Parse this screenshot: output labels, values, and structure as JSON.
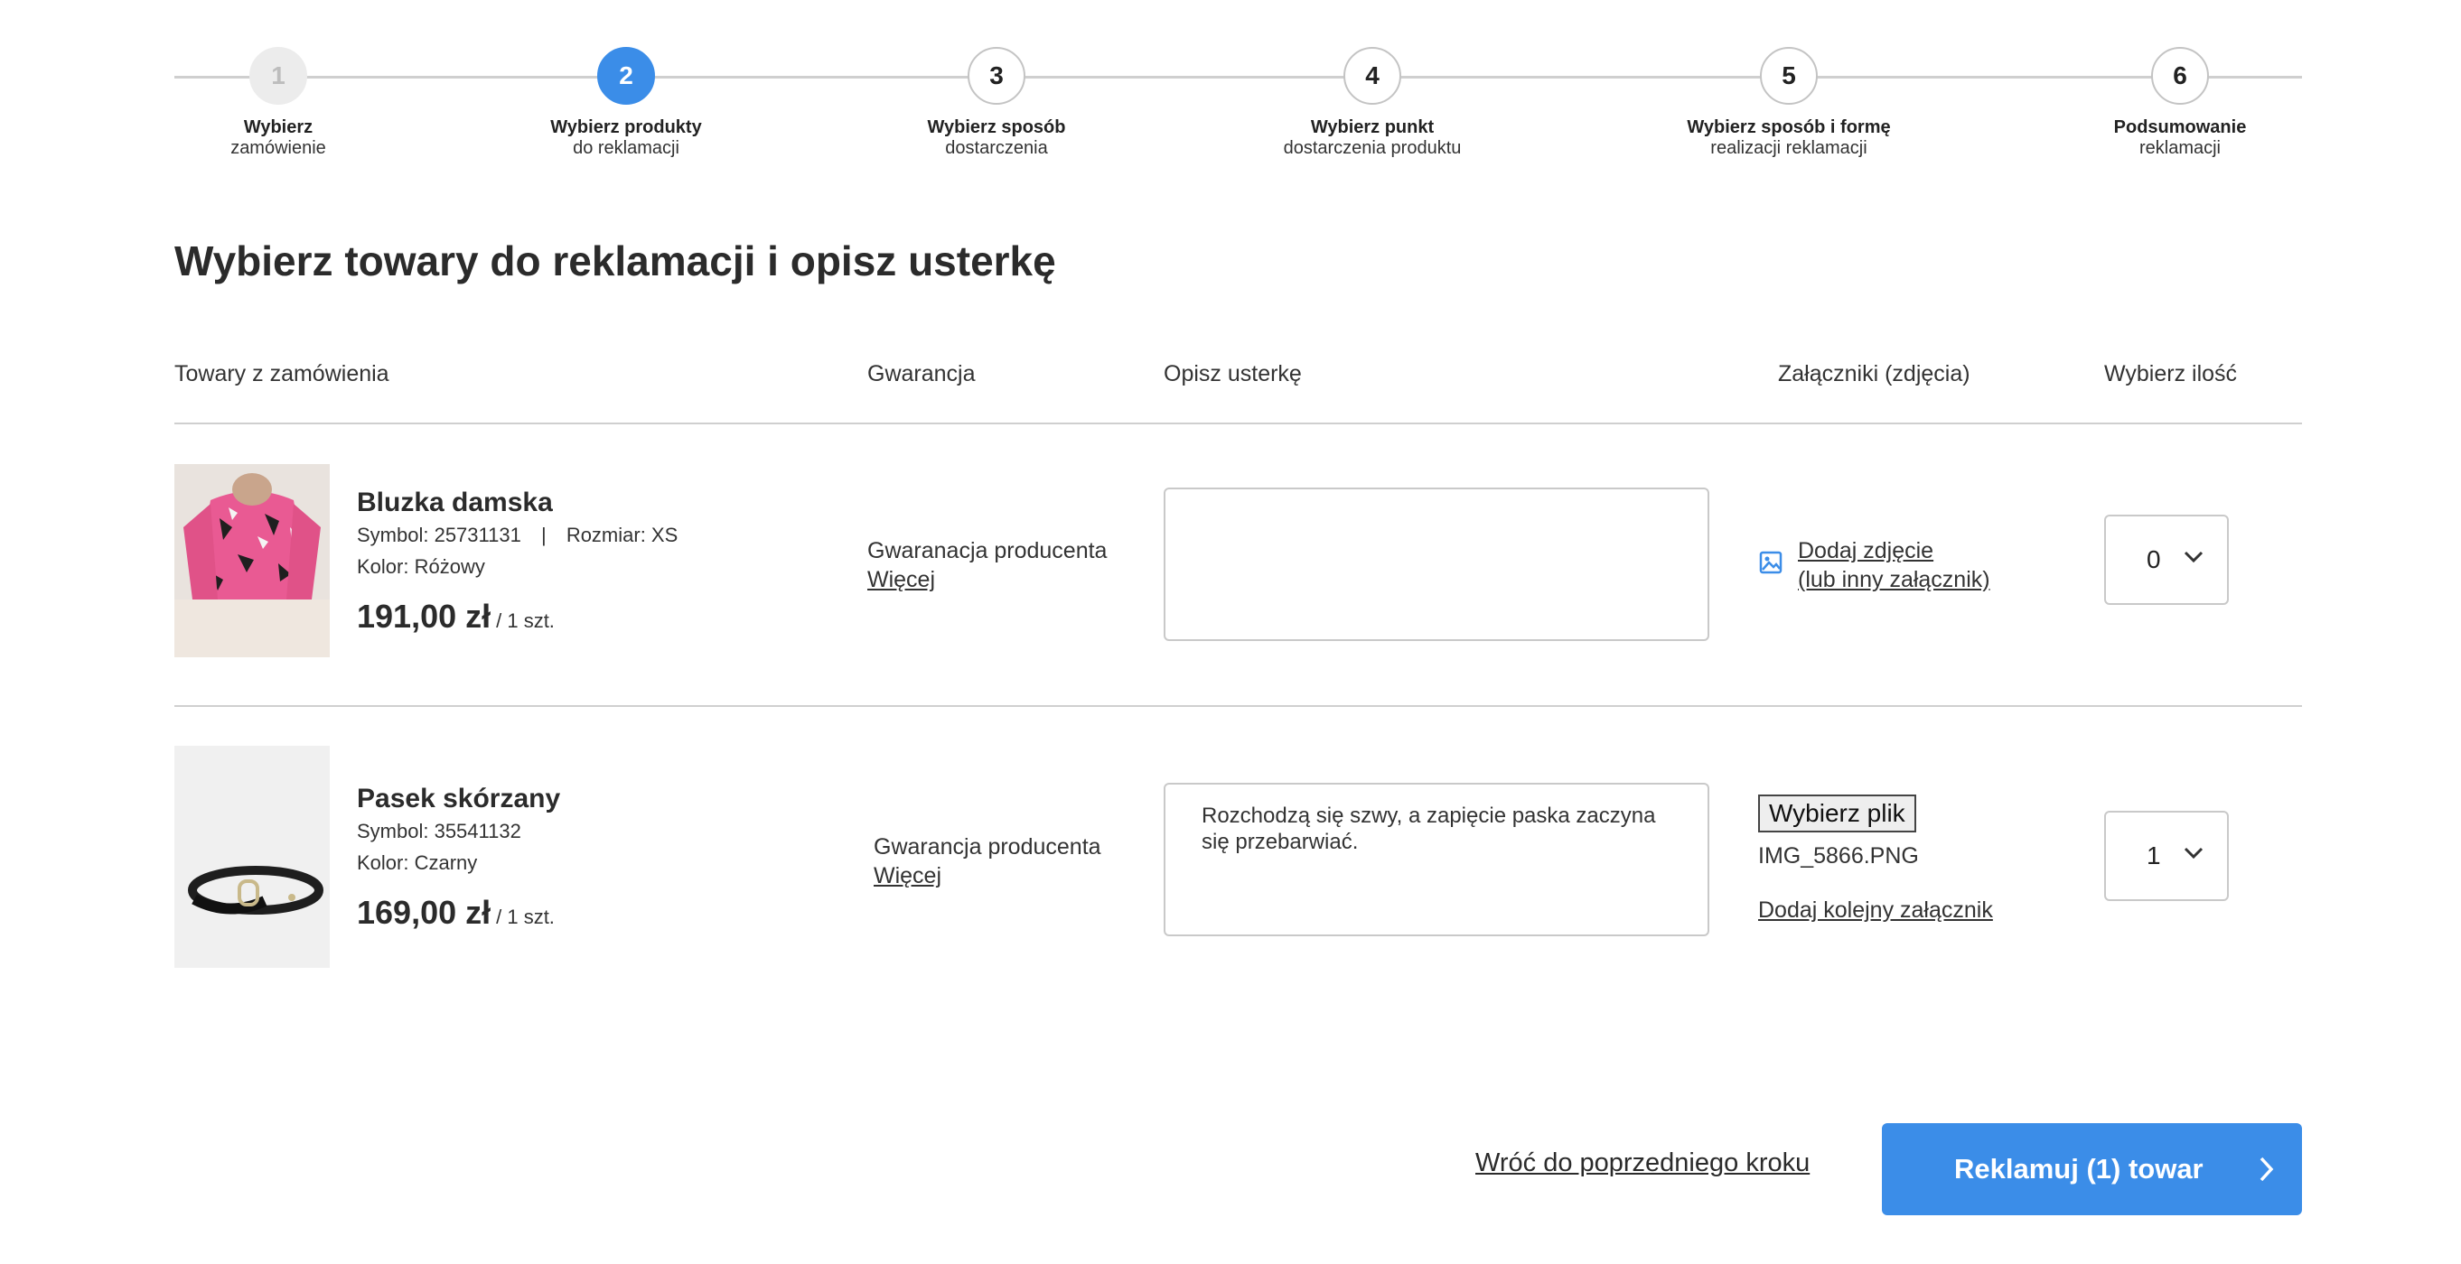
{
  "stepper": {
    "steps": [
      {
        "number": "1",
        "title": "Wybierz",
        "subtitle": "zamówienie",
        "state": "done"
      },
      {
        "number": "2",
        "title": "Wybierz produkty",
        "subtitle": "do reklamacji",
        "state": "active"
      },
      {
        "number": "3",
        "title": "Wybierz sposób",
        "subtitle": "dostarczenia",
        "state": "upcoming"
      },
      {
        "number": "4",
        "title": "Wybierz punkt",
        "subtitle": "dostarczenia produktu",
        "state": "upcoming"
      },
      {
        "number": "5",
        "title": "Wybierz sposób i formę",
        "subtitle": "realizacji reklamacji",
        "state": "upcoming"
      },
      {
        "number": "6",
        "title": "Podsumowanie",
        "subtitle": "reklamacji",
        "state": "upcoming"
      }
    ]
  },
  "page_title": "Wybierz towary do reklamacji i opisz usterkę",
  "table_header": {
    "products": "Towary z zamówienia",
    "warranty": "Gwarancja",
    "description": "Opisz usterkę",
    "attachments": "Załączniki (zdjęcia)",
    "quantity": "Wybierz ilość"
  },
  "items": [
    {
      "name": "Bluzka damska",
      "symbol": "Symbol: 25731131",
      "separator": "|",
      "size": "Rozmiar: XS",
      "color": "Kolor: Różowy",
      "price": "191,00 zł",
      "unit": "/ 1 szt.",
      "warranty": "Gwaranacja producenta",
      "warranty_more": "Więcej",
      "description": "",
      "attach_link_line1": "Dodaj zdjęcie",
      "attach_link_line2": "(lub inny załącznik)",
      "quantity": "0"
    },
    {
      "name": "Pasek skórzany",
      "symbol": "Symbol: 35541132",
      "color": "Kolor: Czarny",
      "price": "169,00 zł",
      "unit": "/ 1 szt.",
      "warranty": "Gwarancja producenta",
      "warranty_more": "Więcej",
      "description": "Rozchodzą się szwy, a zapięcie paska zaczyna się przebarwiać.",
      "file_button": "Wybierz plik",
      "file_name": "IMG_5866.PNG",
      "add_another": "Dodaj kolejny załącznik",
      "quantity": "1"
    }
  ],
  "footer": {
    "back_link": "Wróć do poprzedniego kroku",
    "submit_label": "Reklamuj (1) towar"
  },
  "colors": {
    "accent": "#3b8de8",
    "border": "#c9c9c9",
    "done_step": "#ececec"
  }
}
